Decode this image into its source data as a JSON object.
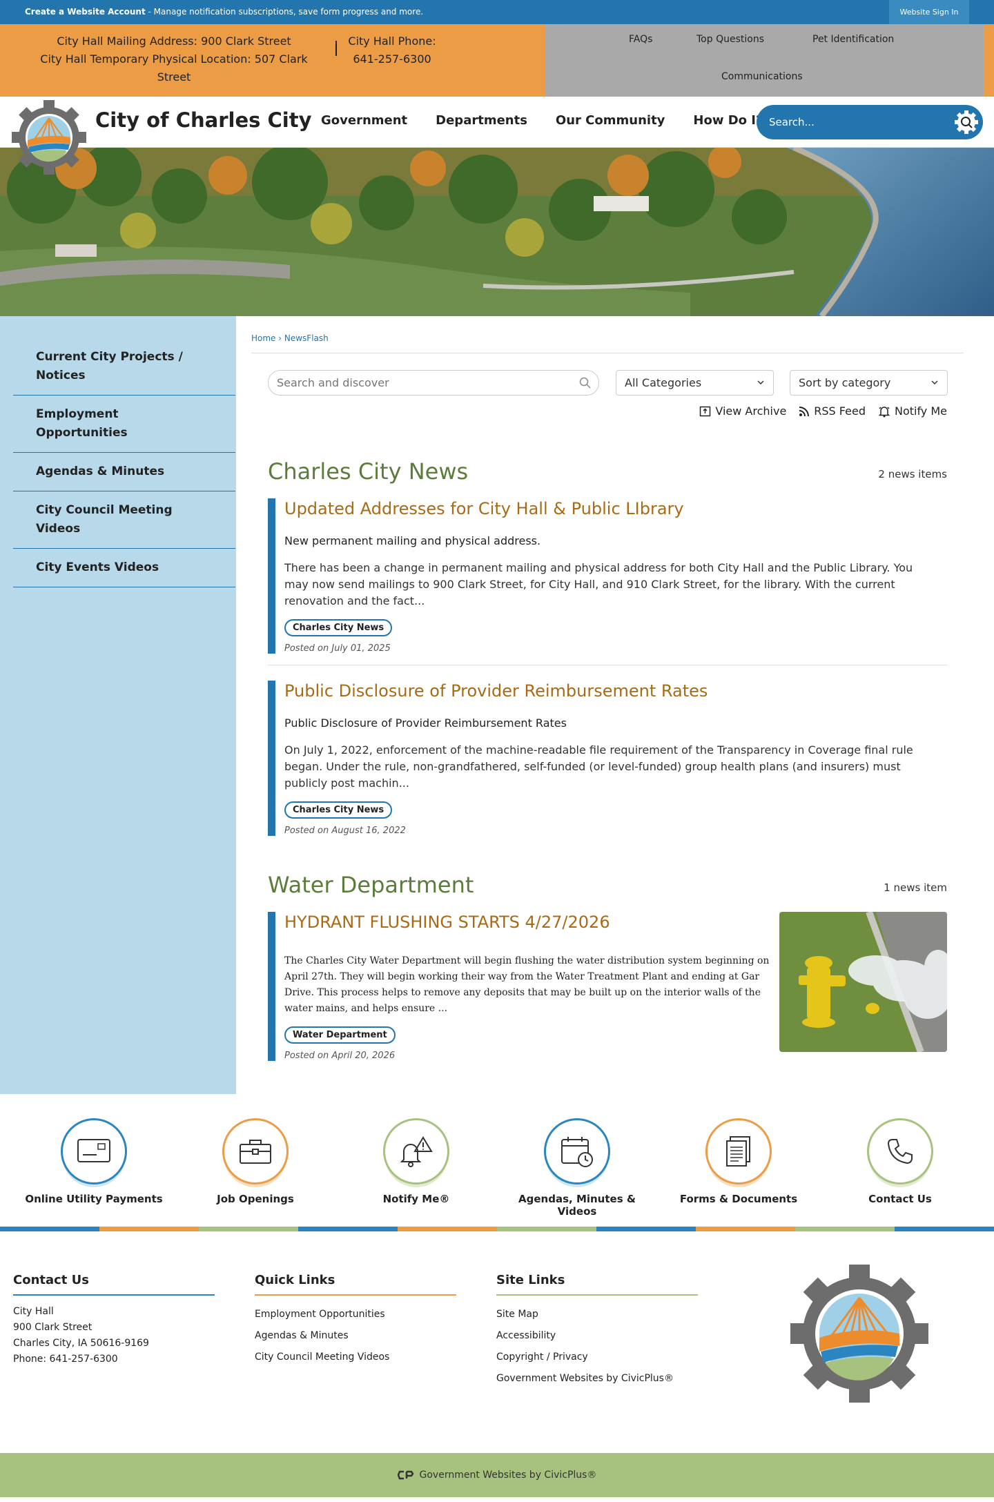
{
  "topbar": {
    "create_bold": "Create a Website Account",
    "create_rest": " - Manage notification subscriptions, save form progress and more.",
    "signin": "Website Sign In"
  },
  "info": {
    "address_line1": "City Hall Mailing Address: 900 Clark Street",
    "address_line2": "City Hall Temporary Physical Location: 507 Clark Street",
    "phone_label": "City Hall Phone:",
    "phone_number": "641-257-6300",
    "links": [
      "FAQs",
      "Top Questions",
      "Pet Identification",
      "Communications"
    ]
  },
  "header": {
    "title": "City of Charles City",
    "nav": [
      "Government",
      "Departments",
      "Our Community",
      "How Do I?"
    ],
    "search_placeholder": "Search..."
  },
  "sidebar": {
    "items": [
      "Current City Projects / Notices",
      "Employment Opportunities",
      "Agendas & Minutes",
      "City Council Meeting Videos",
      "City Events Videos"
    ]
  },
  "breadcrumb": {
    "home": "Home",
    "sep": " › ",
    "current": "NewsFlash"
  },
  "filters": {
    "search_placeholder": "Search and discover",
    "category": "All Categories",
    "sort": "Sort by category",
    "view_archive": "View Archive",
    "rss": "RSS Feed",
    "notify": "Notify Me"
  },
  "sections": [
    {
      "title": "Charles City News",
      "count": "2 news items",
      "items": [
        {
          "title": "Updated Addresses for City Hall & Public LIbrary",
          "teaser": "New permanent mailing and physical address.",
          "body": "There has been a change in permanent mailing and physical address for both City Hall and the Public Library. You may now send mailings to 900 Clark Street, for City Hall, and 910 Clark Street, for the library. With the current renovation and the fact...",
          "tag": "Charles City News",
          "posted": "Posted on July 01, 2025"
        },
        {
          "title": "Public Disclosure of Provider Reimbursement Rates",
          "teaser": "Public Disclosure of Provider Reimbursement Rates",
          "body": "On July 1, 2022, enforcement of the machine-readable file requirement of the Transparency in Coverage final rule began.  Under the rule, non-grandfathered, self-funded (or level-funded) group health plans (and insurers) must publicly post machin...",
          "tag": "Charles City News",
          "posted": "Posted on August 16, 2022"
        }
      ]
    },
    {
      "title": "Water Department",
      "count": "1 news item",
      "items": [
        {
          "title": "HYDRANT FLUSHING STARTS 4/27/2026",
          "body": "The Charles City Water Department will begin flushing the water distribution system beginning on April 27th. They will begin working their way from the Water Treatment Plant and ending at Gar Drive. This process helps to remove any deposits that may be built up on the interior walls of the water mains, and helps ensure ...",
          "tag": "Water Department",
          "posted": "Posted on April 20, 2026"
        }
      ]
    }
  ],
  "quick_links": [
    {
      "label": "Online Utility Payments",
      "icon": "card-icon",
      "color": "#2a85c0"
    },
    {
      "label": "Job Openings",
      "icon": "briefcase-icon",
      "color": "#ec9c44"
    },
    {
      "label": "Notify Me®",
      "icon": "bell-alert-icon",
      "color": "#a6c27e"
    },
    {
      "label": "Agendas, Minutes & Videos",
      "icon": "calendar-clock-icon",
      "color": "#2a85c0"
    },
    {
      "label": "Forms & Documents",
      "icon": "documents-icon",
      "color": "#ec9c44"
    },
    {
      "label": "Contact Us",
      "icon": "phone-icon",
      "color": "#a6c27e"
    }
  ],
  "footer": {
    "contact": {
      "heading": "Contact Us",
      "lines": [
        "City Hall",
        "900 Clark Street",
        "Charles City, IA 50616-9169",
        "Phone: 641-257-6300"
      ]
    },
    "quick": {
      "heading": "Quick Links",
      "links": [
        "Employment Opportunities",
        "Agendas & Minutes",
        "City Council Meeting Videos"
      ]
    },
    "site": {
      "heading": "Site Links",
      "links": [
        "Site Map",
        "Accessibility",
        "Copyright / Privacy",
        "Government Websites by CivicPlus®"
      ]
    }
  },
  "bottom": {
    "text": "Government Websites by CivicPlus®"
  },
  "colors": {
    "blue": "#2276ad",
    "orange": "#ec9c44",
    "green": "#a6c27e",
    "sidebar": "#b7d9ea",
    "heading_green": "#5c7c3c",
    "title_brown": "#a86a15"
  }
}
